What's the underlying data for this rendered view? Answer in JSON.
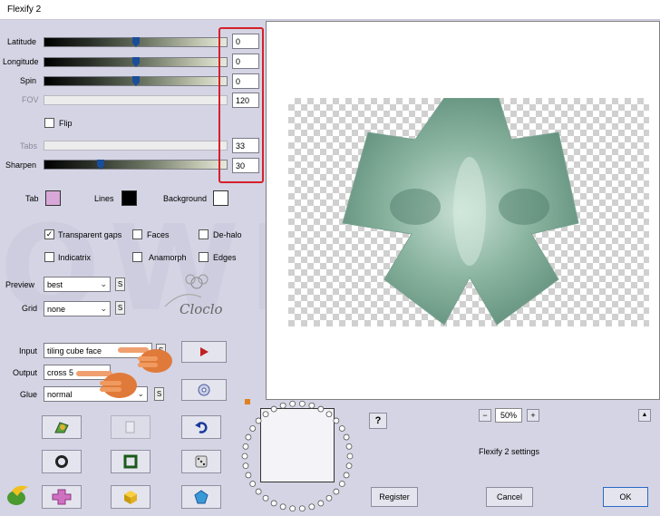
{
  "window": {
    "title": "Flexify 2"
  },
  "sliders": [
    {
      "label": "Latitude",
      "value": "0",
      "level": 0.5,
      "disabled": false
    },
    {
      "label": "Longitude",
      "value": "0",
      "level": 0.5,
      "disabled": false
    },
    {
      "label": "Spin",
      "value": "0",
      "level": 0.5,
      "disabled": false
    },
    {
      "label": "FOV",
      "value": "120",
      "level": null,
      "disabled": true
    },
    {
      "label": "Tabs",
      "value": "33",
      "level": null,
      "disabled": true
    },
    {
      "label": "Sharpen",
      "value": "30",
      "level": 0.3,
      "disabled": false
    }
  ],
  "flip_label": "Flip",
  "colors": {
    "tab_label": "Tab",
    "tab_color": "#d8a8d8",
    "lines_label": "Lines",
    "lines_color": "#000000",
    "background_label": "Background",
    "background_color": "#ffffff",
    "highlight": "#d6202a"
  },
  "checkboxes": {
    "transparent_gaps": {
      "label": "Transparent gaps",
      "checked": true
    },
    "faces": {
      "label": "Faces",
      "checked": false
    },
    "de_halo": {
      "label": "De-halo",
      "checked": false
    },
    "indicatrix": {
      "label": "Indicatrix",
      "checked": false
    },
    "anamorph": {
      "label": "Anamorph",
      "checked": false
    },
    "edges": {
      "label": "Edges",
      "checked": false
    }
  },
  "preview_select": {
    "label": "Preview",
    "value": "best"
  },
  "grid_select": {
    "label": "Grid",
    "value": "none"
  },
  "input_select": {
    "label": "Input",
    "value": "tiling cube face"
  },
  "output_select": {
    "label": "Output",
    "value": "cross 5"
  },
  "glue_select": {
    "label": "Glue",
    "value": "normal"
  },
  "s_label": "S",
  "logo_text": "Cloclo",
  "watermark_text": "OWERSP",
  "zoom": {
    "minus": "−",
    "value": "50%",
    "plus": "+"
  },
  "help_label": "?",
  "collapse_label": "▲",
  "settings_label": "Flexify 2 settings",
  "buttons": {
    "register": "Register",
    "cancel": "Cancel",
    "ok": "OK"
  }
}
